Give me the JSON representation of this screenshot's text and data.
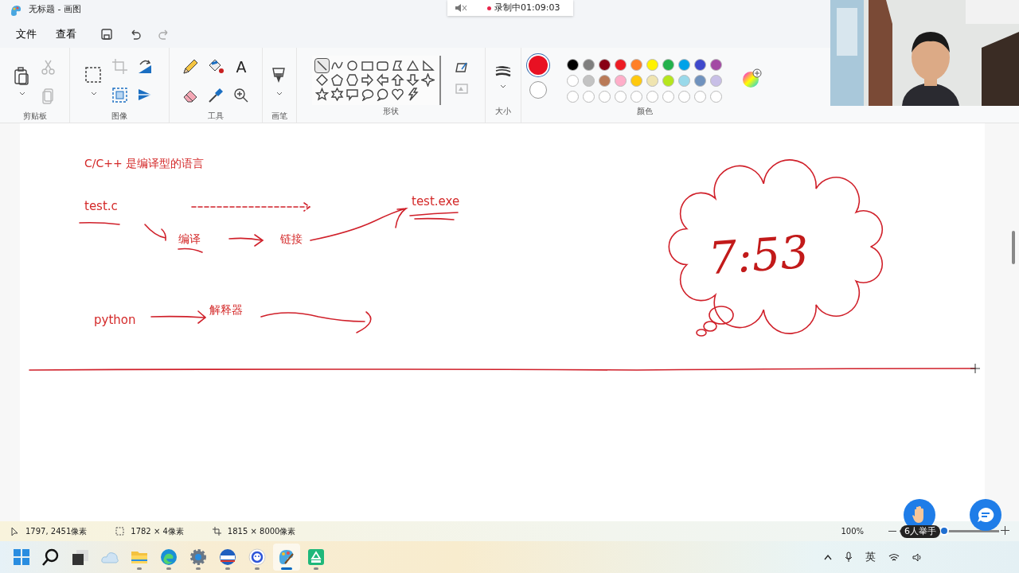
{
  "window": {
    "title": "无标题 - 画图"
  },
  "recording": {
    "text": "录制中01:09:03"
  },
  "menu": [
    {
      "label": "文件"
    },
    {
      "label": "查看"
    }
  ],
  "tool_groups": [
    {
      "label": "剪贴板",
      "tools": [
        {
          "kind": "paste",
          "disabled": false
        },
        {
          "kind": "cut",
          "disabled": true
        },
        {
          "kind": "copy",
          "disabled": true
        }
      ]
    },
    {
      "label": "图像",
      "tools": [
        {
          "kind": "select",
          "disabled": false
        },
        {
          "kind": "crop",
          "disabled": true
        },
        {
          "kind": "resize",
          "disabled": false
        },
        {
          "kind": "rotate",
          "disabled": false
        },
        {
          "kind": "flip",
          "disabled": false
        }
      ]
    },
    {
      "label": "工具",
      "tools": [
        {
          "kind": "pencil",
          "disabled": false
        },
        {
          "kind": "eraser",
          "disabled": false
        },
        {
          "kind": "fill",
          "disabled": false
        },
        {
          "kind": "picker",
          "disabled": false
        },
        {
          "kind": "text",
          "glyph": "A",
          "disabled": false
        },
        {
          "kind": "zoom",
          "disabled": false
        }
      ]
    },
    {
      "label": "画笔",
      "tools": [
        {
          "kind": "brush",
          "disabled": false
        }
      ]
    }
  ],
  "shapes": {
    "label": "形状",
    "items": [
      {
        "kind": "line",
        "selected": true
      },
      {
        "kind": "curve",
        "selected": false
      },
      {
        "kind": "oval",
        "selected": false
      },
      {
        "kind": "rect",
        "selected": false
      },
      {
        "kind": "roundrect",
        "selected": false
      },
      {
        "kind": "polygon",
        "selected": false
      },
      {
        "kind": "triangle",
        "selected": false
      },
      {
        "kind": "righttriangle",
        "selected": false
      },
      {
        "kind": "diamond",
        "selected": false
      },
      {
        "kind": "pentagon",
        "selected": false
      },
      {
        "kind": "hexagon",
        "selected": false
      },
      {
        "kind": "arrowright",
        "selected": false
      },
      {
        "kind": "arrowleft",
        "selected": false
      },
      {
        "kind": "arrowup",
        "selected": false
      },
      {
        "kind": "arrowdown",
        "selected": false
      },
      {
        "kind": "star4",
        "selected": false
      },
      {
        "kind": "star5",
        "selected": false
      },
      {
        "kind": "star6",
        "selected": false
      },
      {
        "kind": "callout",
        "selected": false
      },
      {
        "kind": "ovalcallout",
        "selected": false
      },
      {
        "kind": "cloudcallout",
        "selected": false
      },
      {
        "kind": "heart",
        "selected": false
      },
      {
        "kind": "lightning",
        "selected": false
      }
    ],
    "outline_disabled": false,
    "fill_disabled": true
  },
  "size": {
    "label": "大小"
  },
  "colors": {
    "label": "颜色",
    "current": [
      {
        "color": "#e81123"
      },
      {
        "color": "#ffffff"
      }
    ],
    "palette": [
      {
        "color": "#000000"
      },
      {
        "color": "#7f7f7f"
      },
      {
        "color": "#880015"
      },
      {
        "color": "#ed1c24"
      },
      {
        "color": "#ff7f27"
      },
      {
        "color": "#fff200"
      },
      {
        "color": "#22b14c"
      },
      {
        "color": "#00a2e8"
      },
      {
        "color": "#3f48cc"
      },
      {
        "color": "#a349a4"
      },
      {
        "color": "#ffffff"
      },
      {
        "color": "#c3c3c3"
      },
      {
        "color": "#b97a57"
      },
      {
        "color": "#ffaec9"
      },
      {
        "color": "#ffc90e"
      },
      {
        "color": "#efe4b0"
      },
      {
        "color": "#b5e61d"
      },
      {
        "color": "#99d9ea"
      },
      {
        "color": "#7092be"
      },
      {
        "color": "#c8bfe7"
      }
    ]
  },
  "canvas": {
    "texts": [
      {
        "kind": "heading",
        "text": "C/C++ 是编译型的语言"
      },
      {
        "kind": "source",
        "text": "test.c"
      },
      {
        "kind": "output",
        "text": "test.exe"
      },
      {
        "kind": "compile",
        "text": "编译"
      },
      {
        "kind": "link",
        "text": "链接"
      },
      {
        "kind": "python",
        "text": "python"
      },
      {
        "kind": "interpreter",
        "text": "解释器"
      }
    ],
    "cloud_text": "7:53"
  },
  "status_bar": {
    "cursor": "1797, 2451像素",
    "selection": "1782 × 4像素",
    "size": "1815 × 8000像素",
    "zoom": "100%",
    "zoom_slider": {
      "level": 0.45
    }
  },
  "raise_hand": {
    "label": "6人举手"
  },
  "taskbar": {
    "apps": [
      {
        "kind": "start",
        "running": false,
        "selected": false
      },
      {
        "kind": "search",
        "running": false,
        "selected": false
      },
      {
        "kind": "taskview",
        "running": false,
        "selected": false
      },
      {
        "kind": "weather",
        "running": false,
        "selected": false
      },
      {
        "kind": "explorer",
        "running": true,
        "selected": false
      },
      {
        "kind": "edge",
        "running": true,
        "selected": false
      },
      {
        "kind": "settings",
        "running": true,
        "selected": false
      },
      {
        "kind": "meeting",
        "running": true,
        "selected": false
      },
      {
        "kind": "browser",
        "running": true,
        "selected": false
      },
      {
        "kind": "paint",
        "running": true,
        "selected": true
      },
      {
        "kind": "pdf",
        "running": true,
        "selected": false
      }
    ],
    "ime": "英"
  }
}
